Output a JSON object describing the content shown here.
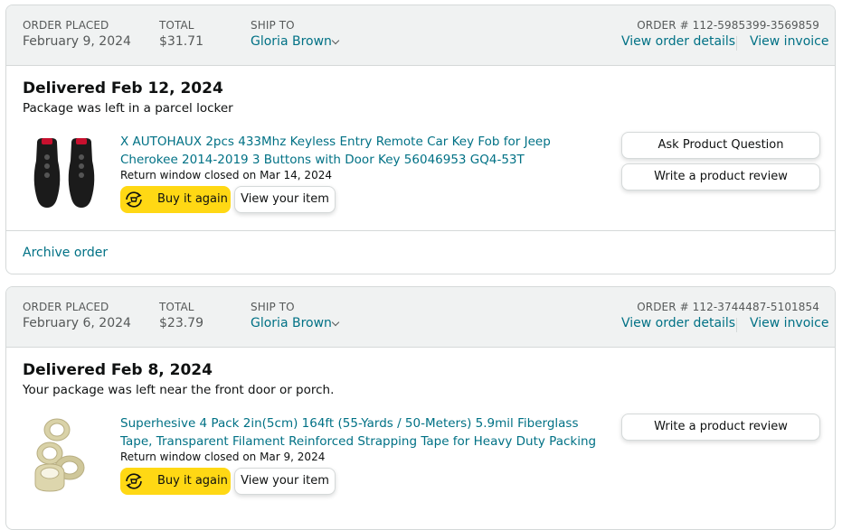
{
  "orders": [
    {
      "order_placed_label": "ORDER PLACED",
      "order_placed": "February 9, 2024",
      "total_label": "TOTAL",
      "total": "$31.71",
      "ship_to_label": "SHIP TO",
      "ship_to": "Gloria Brown",
      "order_number": "ORDER # 112-5985399-3569859",
      "view_order_details": "View order details",
      "view_invoice": "View invoice",
      "delivery_status": "Delivered Feb 12, 2024",
      "delivery_note": "Package was left in a parcel locker",
      "item_title": "X AUTOHAUX 2pcs 433Mhz Keyless Entry Remote Car Key Fob for Jeep Cherokee 2014-2019 3 Buttons with Door Key 56046953 GQ4-53T",
      "return_window": "Return window closed on Mar 14, 2024",
      "buy_again": "Buy it again",
      "view_item": "View your item",
      "ask_question": "Ask Product Question",
      "write_review": "Write a product review",
      "archive": "Archive order"
    },
    {
      "order_placed_label": "ORDER PLACED",
      "order_placed": "February 6, 2024",
      "total_label": "TOTAL",
      "total": "$23.79",
      "ship_to_label": "SHIP TO",
      "ship_to": "Gloria Brown",
      "order_number": "ORDER # 112-3744487-5101854",
      "view_order_details": "View order details",
      "view_invoice": "View invoice",
      "delivery_status": "Delivered Feb 8, 2024",
      "delivery_note": "Your package was left near the front door or porch.",
      "item_title": "Superhesive 4 Pack 2in(5cm) 164ft (55-Yards / 50-Meters) 5.9mil Fiberglass Tape, Transparent Filament Reinforced Strapping Tape for Heavy Duty Packing",
      "return_window": "Return window closed on Mar 9, 2024",
      "buy_again": "Buy it again",
      "view_item": "View your item",
      "write_review": "Write a product review"
    }
  ],
  "icons": {
    "buy_again": "refresh-cart-icon",
    "ship_to_toggle": "chevron-down-icon",
    "product1": "key-fob-image",
    "product2": "tape-rolls-image"
  },
  "colors": {
    "link": "#007185",
    "header_bg": "#f0f2f2",
    "buy_button": "#ffd814",
    "border": "#d5d9d9"
  }
}
